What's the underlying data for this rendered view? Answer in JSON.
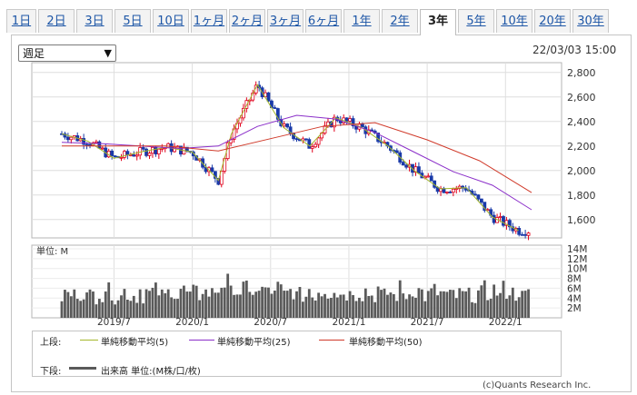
{
  "tabs": [
    {
      "label": "1日",
      "active": false
    },
    {
      "label": "2日",
      "active": false
    },
    {
      "label": "3日",
      "active": false
    },
    {
      "label": "5日",
      "active": false
    },
    {
      "label": "10日",
      "active": false
    },
    {
      "label": "1ヶ月",
      "active": false
    },
    {
      "label": "2ヶ月",
      "active": false
    },
    {
      "label": "3ヶ月",
      "active": false
    },
    {
      "label": "6ヶ月",
      "active": false
    },
    {
      "label": "1年",
      "active": false
    },
    {
      "label": "2年",
      "active": false
    },
    {
      "label": "3年",
      "active": true
    },
    {
      "label": "5年",
      "active": false
    },
    {
      "label": "10年",
      "active": false
    },
    {
      "label": "20年",
      "active": false
    },
    {
      "label": "30年",
      "active": false
    }
  ],
  "period_select": {
    "value": "週足"
  },
  "timestamp": "22/03/03 15:00",
  "colors": {
    "ma5": "#a4b82c",
    "ma25": "#8b2fc9",
    "ma50": "#d03a2a",
    "up": "#e0001b",
    "down": "#1a3aa8",
    "volume": "#5a5a5a"
  },
  "chart_data": [
    {
      "type": "candlestick",
      "panel": "price",
      "y_ticks": [
        "2,800",
        "2,600",
        "2,400",
        "2,200",
        "2,000",
        "1,800",
        "1,600"
      ],
      "ylim": [
        1450,
        2880
      ],
      "x_ticks": [
        "2019/7",
        "2020/1",
        "2020/7",
        "2021/1",
        "2021/7",
        "2022/1"
      ],
      "series": [
        {
          "name": "単純移動平均(5)",
          "values": [
            {
              "x": "2019/3",
              "y": 2300
            },
            {
              "x": "2019/5",
              "y": 2240
            },
            {
              "x": "2019/7",
              "y": 2100
            },
            {
              "x": "2019/9",
              "y": 2150
            },
            {
              "x": "2019/11",
              "y": 2190
            },
            {
              "x": "2020/1",
              "y": 2150
            },
            {
              "x": "2020/3",
              "y": 1920
            },
            {
              "x": "2020/4",
              "y": 2300
            },
            {
              "x": "2020/5",
              "y": 2500
            },
            {
              "x": "2020/6",
              "y": 2700
            },
            {
              "x": "2020/8",
              "y": 2350
            },
            {
              "x": "2020/10",
              "y": 2200
            },
            {
              "x": "2020/12",
              "y": 2430
            },
            {
              "x": "2021/2",
              "y": 2350
            },
            {
              "x": "2021/4",
              "y": 2200
            },
            {
              "x": "2021/6",
              "y": 2000
            },
            {
              "x": "2021/8",
              "y": 1850
            },
            {
              "x": "2021/10",
              "y": 1860
            },
            {
              "x": "2021/12",
              "y": 1620
            },
            {
              "x": "2022/2",
              "y": 1510
            }
          ]
        },
        {
          "name": "単純移動平均(25)",
          "values": [
            {
              "x": "2019/3",
              "y": 2230
            },
            {
              "x": "2019/6",
              "y": 2220
            },
            {
              "x": "2019/9",
              "y": 2200
            },
            {
              "x": "2019/12",
              "y": 2180
            },
            {
              "x": "2020/3",
              "y": 2200
            },
            {
              "x": "2020/6",
              "y": 2360
            },
            {
              "x": "2020/9",
              "y": 2450
            },
            {
              "x": "2020/12",
              "y": 2420
            },
            {
              "x": "2021/3",
              "y": 2310
            },
            {
              "x": "2021/6",
              "y": 2150
            },
            {
              "x": "2021/9",
              "y": 1990
            },
            {
              "x": "2021/12",
              "y": 1880
            },
            {
              "x": "2022/3",
              "y": 1680
            }
          ]
        },
        {
          "name": "単純移動平均(50)",
          "values": [
            {
              "x": "2019/3",
              "y": 2200
            },
            {
              "x": "2019/7",
              "y": 2200
            },
            {
              "x": "2019/11",
              "y": 2200
            },
            {
              "x": "2020/3",
              "y": 2160
            },
            {
              "x": "2020/7",
              "y": 2260
            },
            {
              "x": "2020/11",
              "y": 2360
            },
            {
              "x": "2021/3",
              "y": 2390
            },
            {
              "x": "2021/7",
              "y": 2250
            },
            {
              "x": "2021/11",
              "y": 2080
            },
            {
              "x": "2022/3",
              "y": 1820
            }
          ]
        }
      ]
    },
    {
      "type": "bar",
      "panel": "volume",
      "y_ticks": [
        "14M",
        "12M",
        "10M",
        "8M",
        "6M",
        "4M",
        "2M"
      ],
      "ylim": [
        0,
        14
      ],
      "y_unit_label": "単位: M",
      "x_ticks": [
        "2019/7",
        "2020/1",
        "2020/7",
        "2021/1",
        "2021/7",
        "2022/1"
      ]
    }
  ],
  "legend": {
    "upper_label": "上段:",
    "lower_label": "下段:",
    "ma5": "単純移動平均(5)",
    "ma25": "単純移動平均(25)",
    "ma50": "単純移動平均(50)",
    "volume": "出来高 単位:(M株/口/枚)"
  },
  "copyright": "(c)Quants Research Inc."
}
